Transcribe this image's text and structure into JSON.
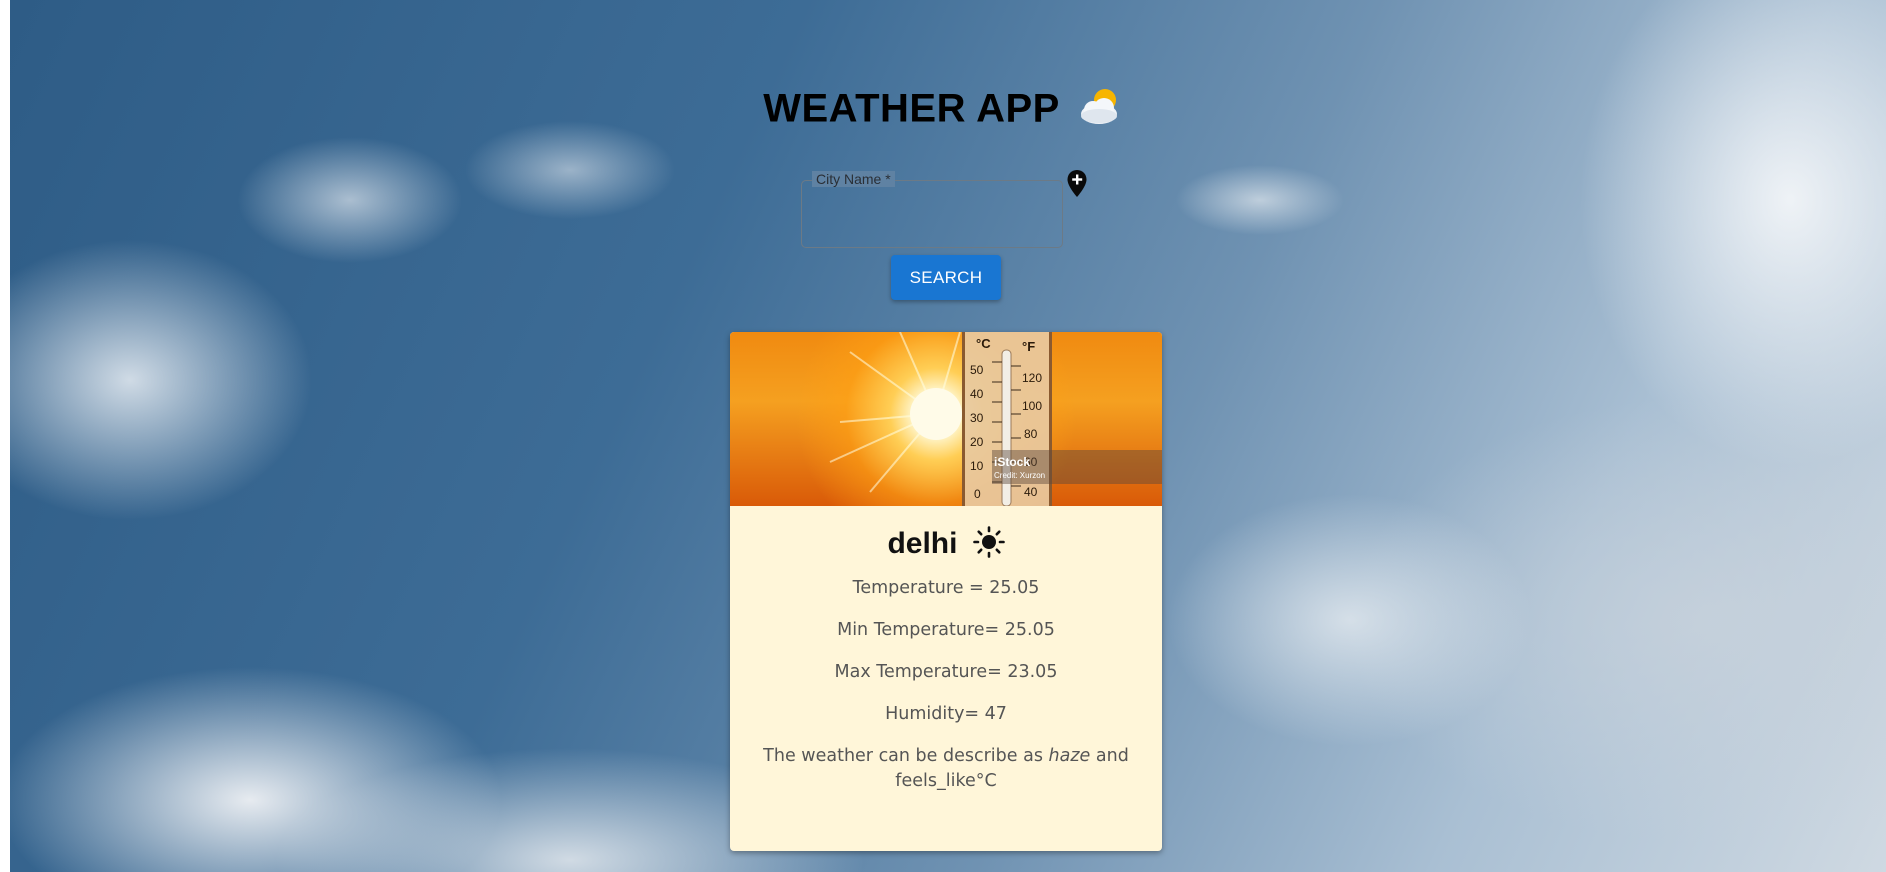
{
  "header": {
    "title": "WEATHER APP"
  },
  "search": {
    "label": "City Name *",
    "value": "",
    "button_label": "SEARCH"
  },
  "card": {
    "image_caption": {
      "brand": "iStock",
      "credit": "Credit: Xurzon"
    },
    "city": "delhi",
    "temperature": "Temperature = 25.05",
    "min_temperature": "Min Temperature= 25.05",
    "max_temperature": "Max Temperature= 23.05",
    "humidity": "Humidity= 47",
    "description_prefix": "The weather can be describe as",
    "description_condition": "haze",
    "description_suffix": "and feels_like°C"
  },
  "thermometer": {
    "celsius_unit": "°C",
    "fahrenheit_unit": "°F",
    "celsius_ticks": [
      "50",
      "40",
      "30",
      "20",
      "10",
      "0"
    ],
    "fahrenheit_ticks": [
      "120",
      "100",
      "80",
      "60",
      "40"
    ]
  },
  "icons": {
    "title_icon": "sun-behind-cloud-icon",
    "location_icon": "add-location-icon",
    "city_icon": "sun-icon"
  },
  "colors": {
    "button": "#1976d2",
    "card_background": "#fff6d9",
    "title": "#000000"
  }
}
